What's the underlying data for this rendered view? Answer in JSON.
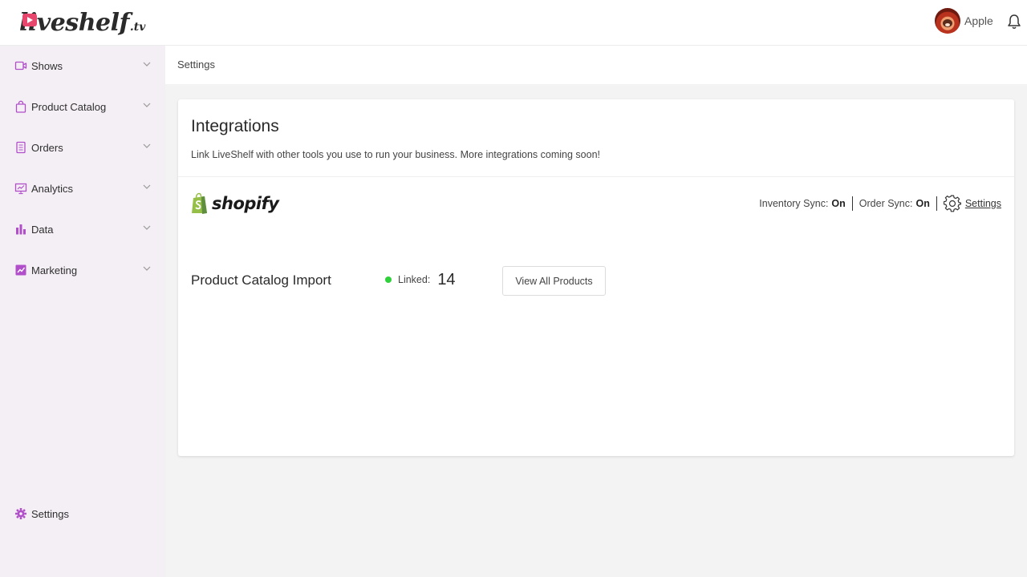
{
  "header": {
    "logo_text": "liveshelf",
    "logo_suffix": ".tv",
    "user_name": "Apple",
    "brand_color": "#e8476d"
  },
  "sidebar": {
    "accent_color": "#b04fc9",
    "items": [
      {
        "label": "Shows",
        "icon": "video-camera-icon"
      },
      {
        "label": "Product Catalog",
        "icon": "shopping-bag-icon"
      },
      {
        "label": "Orders",
        "icon": "document-icon"
      },
      {
        "label": "Analytics",
        "icon": "presentation-chart-icon"
      },
      {
        "label": "Data",
        "icon": "bar-chart-icon"
      },
      {
        "label": "Marketing",
        "icon": "trend-chart-icon"
      }
    ],
    "settings_label": "Settings"
  },
  "breadcrumb": "Settings",
  "integrations": {
    "title": "Integrations",
    "subtitle": "Link LiveShelf with other tools you use to run your business. More integrations coming soon!",
    "shopify": {
      "name": "shopify",
      "inventory_sync_label": "Inventory Sync:",
      "inventory_sync_value": "On",
      "order_sync_label": "Order Sync:",
      "order_sync_value": "On",
      "settings_link": "Settings"
    },
    "catalog_import": {
      "title": "Product Catalog Import",
      "linked_label": "Linked:",
      "linked_count": "14",
      "status_color": "#2fd13a",
      "view_button": "View All Products"
    }
  }
}
